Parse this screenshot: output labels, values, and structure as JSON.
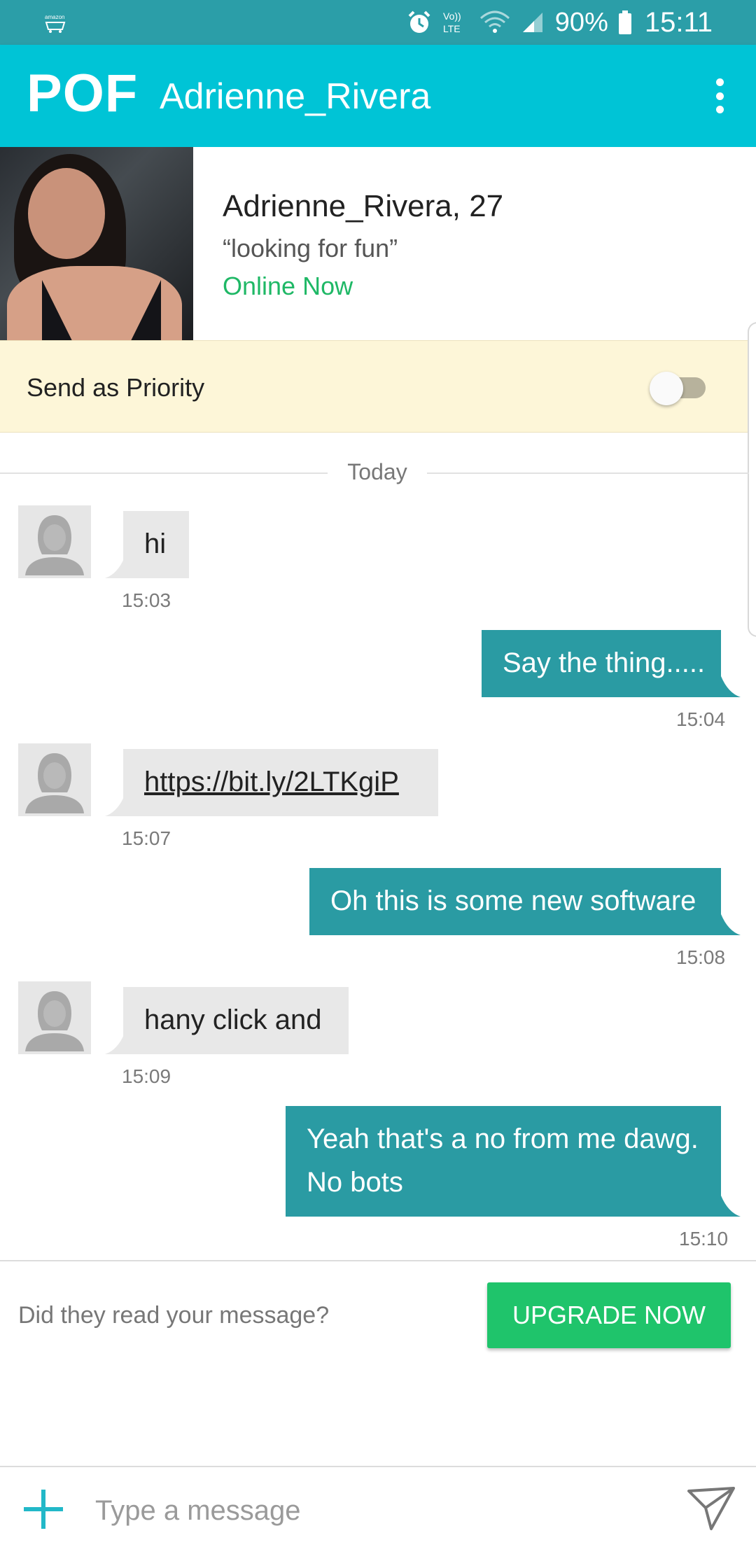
{
  "status_bar": {
    "left_icon": "amazon-shopping-icon",
    "icons": [
      "alarm-icon",
      "volte-icon",
      "wifi-icon",
      "signal-icon"
    ],
    "volte_label": "Vo)) LTE",
    "battery_pct": "90%",
    "time": "15:11"
  },
  "header": {
    "logo": "POF",
    "title": "Adrienne_Rivera",
    "menu_icon": "kebab-menu-icon"
  },
  "profile": {
    "name_age": "Adrienne_Rivera, 27",
    "tagline": "“looking for fun”",
    "status": "Online Now"
  },
  "priority": {
    "label": "Send as Priority",
    "enabled": false
  },
  "date_divider": "Today",
  "messages": [
    {
      "direction": "in",
      "text": "hi",
      "time": "15:03"
    },
    {
      "direction": "out",
      "text": "Say the thing.....",
      "time": "15:04"
    },
    {
      "direction": "in",
      "text": "https://bit.ly/2LTKgiP",
      "time": "15:07"
    },
    {
      "direction": "out",
      "text": "Oh this is some new software",
      "time": "15:08"
    },
    {
      "direction": "in",
      "text": "hany click and",
      "time": "15:09"
    },
    {
      "direction": "out",
      "text_line1": "Yeah that's a no from me dawg.",
      "text_line2": "No bots",
      "time": "15:10"
    }
  ],
  "upsell": {
    "text": "Did they read your message?",
    "button": "UPGRADE NOW"
  },
  "composer": {
    "placeholder": "Type a message"
  },
  "colors": {
    "status_bar": "#2b9ea8",
    "header": "#00c4d6",
    "outgoing_bubble": "#2a9ba3",
    "incoming_bubble": "#e8e8e8",
    "online": "#1fb866",
    "upgrade": "#1fc46b",
    "priority_bg": "#fdf6d8"
  }
}
